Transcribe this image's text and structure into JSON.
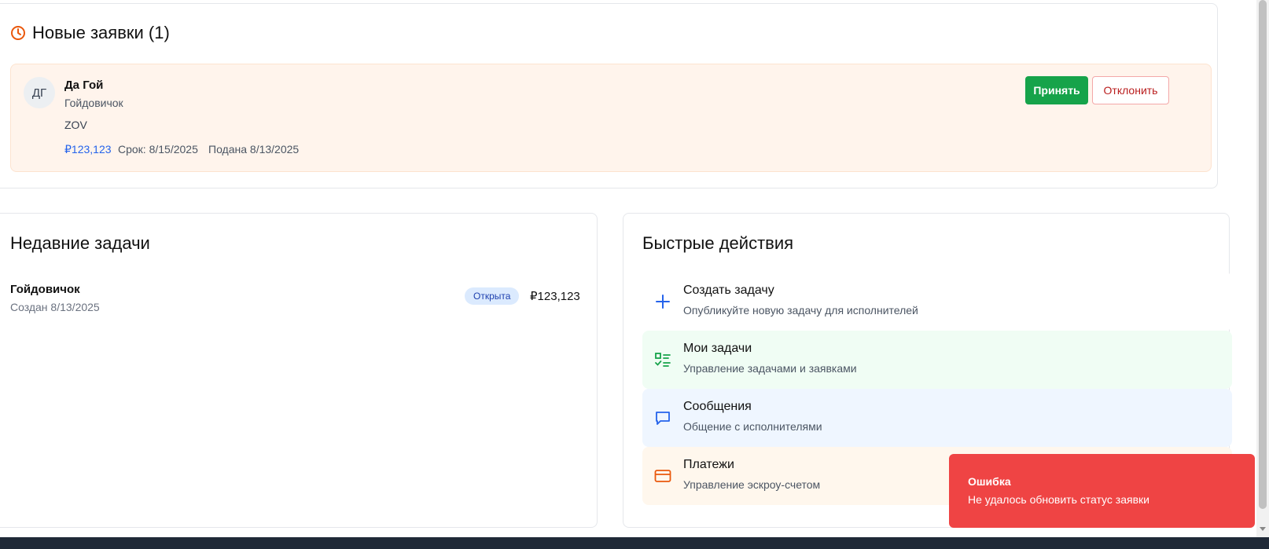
{
  "applications": {
    "title": "Новые заявки (1)",
    "items": [
      {
        "initials": "ДГ",
        "name": "Да Гой",
        "task": "Гойдовичок",
        "message": "ZOV",
        "price": "₽123,123",
        "deadline": "Срок: 8/15/2025",
        "submitted": "Подана 8/13/2025",
        "accept_label": "Принять",
        "reject_label": "Отклонить"
      }
    ]
  },
  "recent_tasks": {
    "title": "Недавние задачи",
    "items": [
      {
        "title": "Гойдовичок",
        "created": "Создан 8/13/2025",
        "status": "Открыта",
        "price": "₽123,123"
      }
    ]
  },
  "quick_actions": {
    "title": "Быстрые действия",
    "items": [
      {
        "icon": "plus-icon",
        "title": "Создать задачу",
        "desc": "Опубликуйте новую задачу для исполнителей",
        "bg": "#ffffff",
        "color": "#2563eb"
      },
      {
        "icon": "list-check-icon",
        "title": "Мои задачи",
        "desc": "Управление задачами и заявками",
        "bg": "#f0fdf4",
        "color": "#16a34a"
      },
      {
        "icon": "message-icon",
        "title": "Сообщения",
        "desc": "Общение с исполнителями",
        "bg": "#eff6ff",
        "color": "#2563eb"
      },
      {
        "icon": "credit-card-icon",
        "title": "Платежи",
        "desc": "Управление эскроу-счетом",
        "bg": "#fff7ed",
        "color": "#ea580c"
      }
    ]
  },
  "toast": {
    "title": "Ошибка",
    "message": "Не удалось обновить статус заявки",
    "color": "#ef4444"
  },
  "colors": {
    "accent_orange": "#ea580c",
    "accent_blue": "#2563eb",
    "accept_green": "#16a34a"
  }
}
